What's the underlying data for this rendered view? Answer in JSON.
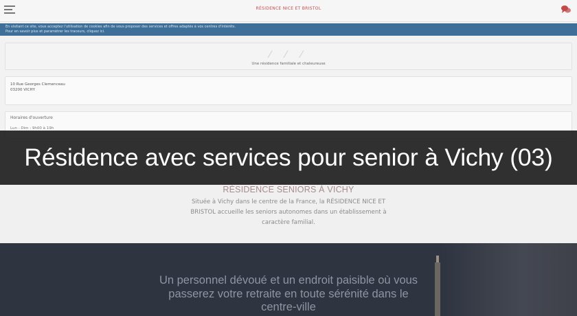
{
  "header": {
    "site_title": "RÉSIDENCE NICE ET BRISTOL",
    "menu_icon": "hamburger-icon",
    "chat_icon": "chat-bubbles-icon"
  },
  "notice": {
    "line1": "En visitant ce site, vous acceptez l'utilisation de cookies afin de vous proposer des services et offres adaptés à vos centres d'intérêts.",
    "line2": "Pour en savoir plus et paramétrer les traceurs, cliquez ici."
  },
  "hero": {
    "tagline": "Une résidence familiale et chaleureuse"
  },
  "address": {
    "street": "10 Rue Georges Clemenceau",
    "city": "03200 VICHY"
  },
  "hours": {
    "label": "Horaires d'ouverture",
    "row": "Lun - Dim : 9h00 à 19h"
  },
  "overlay": {
    "title": "Résidence avec services pour senior à Vichy (03)"
  },
  "residence": {
    "heading": "RÉSIDENCE SENIORS À VICHY",
    "description": "Située à Vichy dans le centre de la France, la RÉSIDENCE NICE ET BRISTOL accueille les seniors autonomes dans un établissement à caractère familial."
  },
  "slogan": {
    "line1": "Un personnel dévoué et un endroit paisible où vous",
    "line2": "passerez votre retraite en toute sérénité dans le",
    "line3": "centre-ville"
  },
  "colors": {
    "brand_red": "#c24a4a",
    "notice_blue": "#3e6f98",
    "dark_section": "#2e3440"
  }
}
